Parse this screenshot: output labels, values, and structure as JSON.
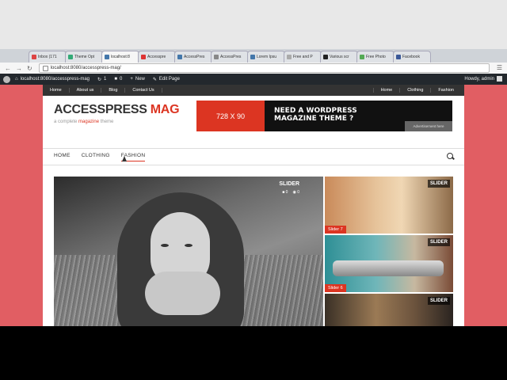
{
  "browser": {
    "tabs": [
      {
        "label": "Inbox (171",
        "color": "#d44"
      },
      {
        "label": "Theme Opt",
        "color": "#3a7"
      },
      {
        "label": "localhost:8",
        "color": "#47a",
        "active": true
      },
      {
        "label": "Accesspre",
        "color": "#d33"
      },
      {
        "label": "AccessPres",
        "color": "#47a"
      },
      {
        "label": "AccessPres",
        "color": "#888"
      },
      {
        "label": "Lorem Ipsu",
        "color": "#47a"
      },
      {
        "label": "Free and P",
        "color": "#aaa"
      },
      {
        "label": "Various scr",
        "color": "#222"
      },
      {
        "label": "Free Photo",
        "color": "#5a5"
      },
      {
        "label": "Facebook",
        "color": "#3b5998"
      }
    ],
    "url": "localhost:8080/accesspress-mag/"
  },
  "adminbar": {
    "site": "localhost:8080/accesspress-mag",
    "updates": "1",
    "comments": "0",
    "new": "New",
    "edit": "Edit Page",
    "howdy": "Howdy, admin"
  },
  "topnav": {
    "left": [
      "Home",
      "About us",
      "Blog",
      "Contact Us"
    ],
    "right": [
      "Home",
      "Clothing",
      "Fashion"
    ]
  },
  "logo": {
    "title_main": "ACCESSPRESS ",
    "title_accent": "MAG",
    "tagline_pre": "a complete ",
    "tagline_accent": "magazine",
    "tagline_post": " theme"
  },
  "ad": {
    "size": "728 X 90",
    "line1": "NEED A WORDPRESS",
    "line2": "MAGAZINE THEME ?",
    "button": "Advertisement here"
  },
  "mainnav": [
    "HOME",
    "CLOTHING",
    "FASHION"
  ],
  "slider": {
    "main": {
      "label": "SLIDER",
      "comments": "0",
      "views": "0"
    },
    "side": [
      {
        "label": "SLIDER",
        "caption": "Slider 7"
      },
      {
        "label": "SLIDER",
        "caption": "Slider 6"
      },
      {
        "label": "SLIDER",
        "caption": ""
      }
    ]
  },
  "colors": {
    "accent": "#dc3522",
    "site_bg": "#e15e63",
    "adminbar": "#23282d"
  }
}
